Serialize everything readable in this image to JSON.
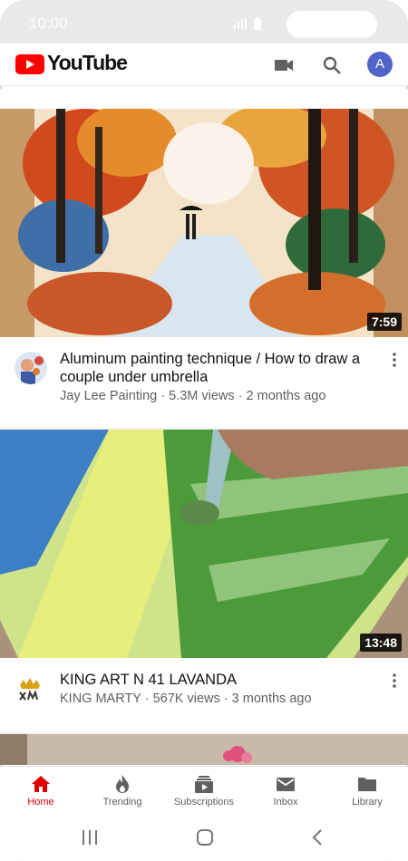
{
  "status_bar": {
    "time": "10:00"
  },
  "header": {
    "logo_text": "YouTube",
    "avatar_letter": "A"
  },
  "videos": [
    {
      "title": "Aluminum painting technique / How to draw a couple under umbrella",
      "channel": "Jay Lee Painting",
      "views": "5.3M views",
      "age": "2 months ago",
      "duration": "7:59"
    },
    {
      "title": "KING ART N 41 LAVANDA",
      "channel": "KING MARTY",
      "views": "567K views",
      "age": "3 months ago",
      "duration": "13:48"
    }
  ],
  "bottom_nav": [
    {
      "label": "Home",
      "icon": "home-icon",
      "active": true
    },
    {
      "label": "Trending",
      "icon": "fire-icon"
    },
    {
      "label": "Subscriptions",
      "icon": "subscriptions-icon"
    },
    {
      "label": "Inbox",
      "icon": "mail-icon"
    },
    {
      "label": "Library",
      "icon": "folder-icon"
    }
  ],
  "colors": {
    "brand_red": "#ff0000",
    "active_red": "#e00000",
    "avatar_blue": "#4f63c9"
  }
}
